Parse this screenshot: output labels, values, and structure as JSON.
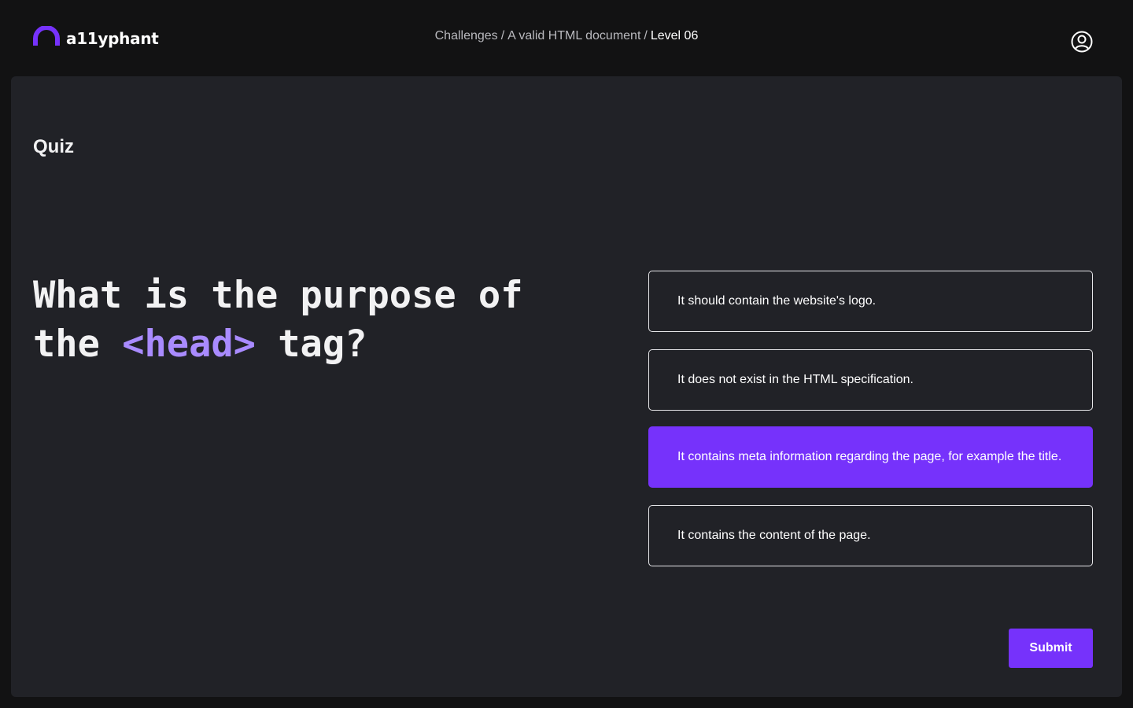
{
  "app": {
    "logo_text": "a11yphant"
  },
  "breadcrumb": {
    "items": [
      "Challenges",
      "A valid HTML document"
    ],
    "separator": "/",
    "current": "Level 06"
  },
  "quiz": {
    "label": "Quiz",
    "question_prefix": "What is the purpose of the",
    "question_code": "<head>",
    "question_suffix": "tag?",
    "answers": [
      {
        "text": "It should contain the website's logo.",
        "selected": false
      },
      {
        "text": "It does not exist in the HTML specification.",
        "selected": false
      },
      {
        "text": "It contains meta information regarding the page, for example the title.",
        "selected": true
      },
      {
        "text": "It contains the content of the page.",
        "selected": false
      }
    ],
    "submit_label": "Submit"
  },
  "icons": {
    "logo": "logo-arch-icon",
    "account": "user-circle-icon"
  },
  "colors": {
    "background": "#121213",
    "panel": "#212227",
    "accent": "#7632fb",
    "code_highlight": "#a98bff",
    "text": "#f2f2f3"
  }
}
